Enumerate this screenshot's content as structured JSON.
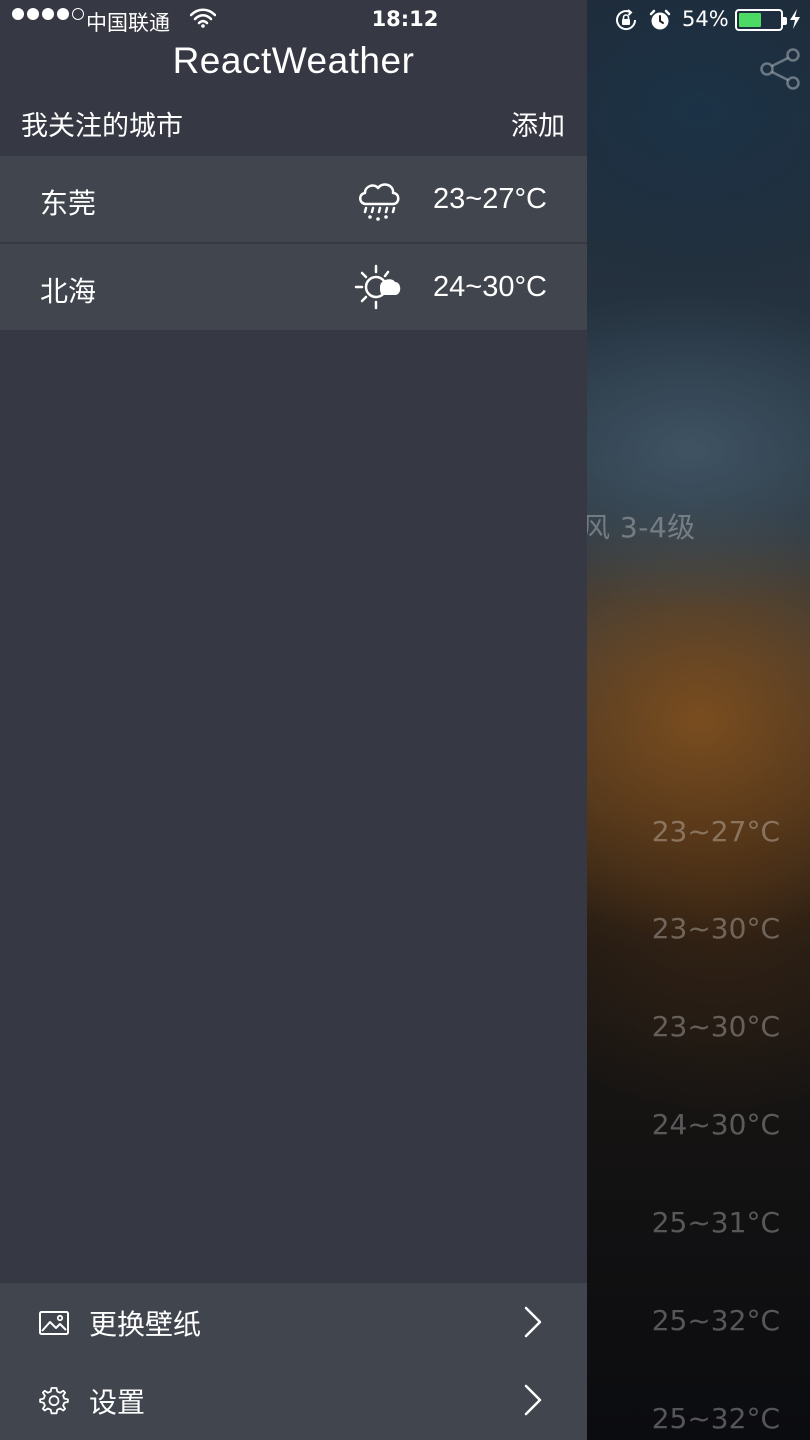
{
  "status_bar": {
    "carrier": "中国联通",
    "time": "18:12",
    "battery_percent": "54%",
    "battery_level": 0.54,
    "signal_bars_filled": 4,
    "signal_bars_total": 5
  },
  "drawer": {
    "title": "ReactWeather",
    "section_title": "我关注的城市",
    "add_label": "添加",
    "cities": [
      {
        "name": "东莞",
        "icon": "rain-cloud-icon",
        "temp": "23~27°C"
      },
      {
        "name": "北海",
        "icon": "sun-cloud-icon",
        "temp": "24~30°C"
      }
    ],
    "menu": [
      {
        "icon": "image-icon",
        "label": "更换壁纸"
      },
      {
        "icon": "gear-icon",
        "label": "设置"
      }
    ]
  },
  "background": {
    "wind_partial": "风 3-4级",
    "forecast_temps": [
      "23~27°C",
      "23~30°C",
      "23~30°C",
      "24~30°C",
      "25~31°C",
      "25~32°C",
      "25~32°C"
    ]
  },
  "colors": {
    "drawer_bg": "#363943",
    "row_bg": "#40454e",
    "battery_fill": "#4cd964"
  }
}
